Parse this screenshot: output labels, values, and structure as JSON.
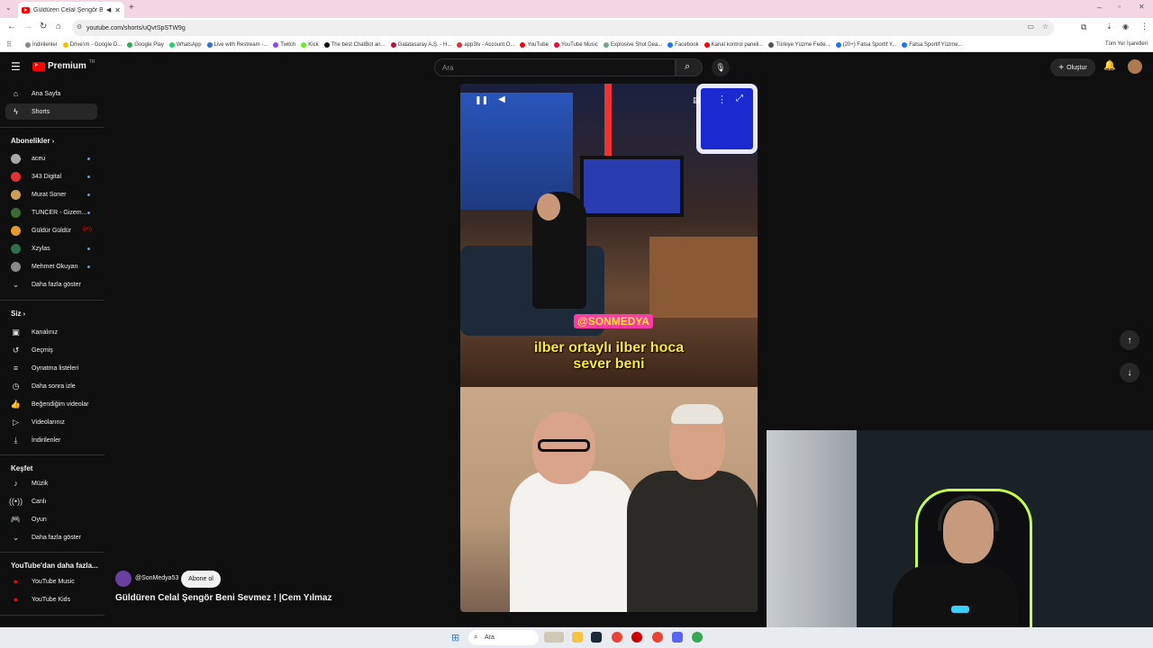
{
  "browser": {
    "tab_title": "Güldüren Celal Şengör Beni",
    "url": "youtube.com/shorts/uQvtSpSTW9g",
    "bookmarks": [
      "İndirilenler",
      "Drive'ım - Google D...",
      "Google Play",
      "WhatsApp",
      "Live with Restream -...",
      "Twitch",
      "Kick",
      "The best ChatBot an...",
      "Galatasaray A.Ş. - H...",
      "app3tv - Account O...",
      "YouTube",
      "YouTube Music",
      "Explosive Shot Dea...",
      "Facebook",
      "Kanal kontrol paneli...",
      "Türkiye Yüzme Fede...",
      "(20+) Fatsa Sportif Y...",
      "Fatsa Sportif Yüzme..."
    ],
    "all_bookmarks": "Tüm Yer İşaretleri"
  },
  "header": {
    "logo": "Premium",
    "logo_sup": "TR",
    "search_placeholder": "Ara",
    "create_label": "Oluştur"
  },
  "sidebar": {
    "main": [
      {
        "label": "Ana Sayfa",
        "icon": "home-icon"
      },
      {
        "label": "Shorts",
        "icon": "shorts-icon"
      }
    ],
    "subs_title": "Abonelikler",
    "subs": [
      {
        "label": "aceu",
        "color": "#a8a8a8"
      },
      {
        "label": "343 Digital",
        "color": "#d33"
      },
      {
        "label": "Murat Soner",
        "color": "#c9a057"
      },
      {
        "label": "TUNCER - Gizem...",
        "color": "#3a6b35"
      },
      {
        "label": "Güldür Güldür",
        "color": "#e39a2d"
      },
      {
        "label": "Xzylas",
        "color": "#2f6e4a"
      },
      {
        "label": "Mehmet Okuyan",
        "color": "#888"
      }
    ],
    "show_more": "Daha fazla göster",
    "you_title": "Siz",
    "you": [
      {
        "label": "Kanalınız",
        "icon": "channel-icon"
      },
      {
        "label": "Geçmiş",
        "icon": "history-icon"
      },
      {
        "label": "Oynatma listeleri",
        "icon": "playlist-icon"
      },
      {
        "label": "Daha sonra izle",
        "icon": "watch-later-icon"
      },
      {
        "label": "Beğendiğim videolar",
        "icon": "like-icon"
      },
      {
        "label": "Videolarınız",
        "icon": "videos-icon"
      },
      {
        "label": "İndirilenler",
        "icon": "download-icon"
      }
    ],
    "explore_title": "Keşfet",
    "explore": [
      {
        "label": "Müzik",
        "icon": "music-icon"
      },
      {
        "label": "Canlı",
        "icon": "live-icon"
      },
      {
        "label": "Oyun",
        "icon": "gaming-icon"
      }
    ],
    "explore_more": "Daha fazla göster",
    "more_title": "YouTube'dan daha fazla...",
    "more": [
      {
        "label": "YouTube Music"
      },
      {
        "label": "YouTube Kids"
      }
    ]
  },
  "short": {
    "caption_line1": "ilber ortaylı ilber hoca",
    "caption_line2": "sever beni",
    "watermark": "@SONMEDYA",
    "channel": "@SonMedya53",
    "subscribe": "Abone ol",
    "title": "Güldüren Celal Şengör Beni Sevmez ! |Cem Yılmaz"
  },
  "taskbar": {
    "search": "Ara"
  }
}
